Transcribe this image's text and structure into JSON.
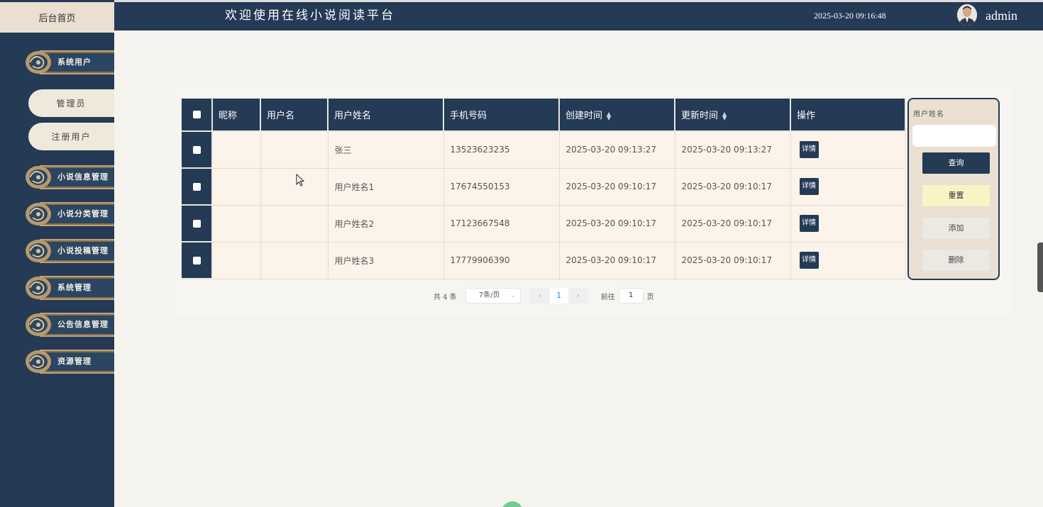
{
  "header": {
    "title": "欢迎使用在线小说阅读平台",
    "datetime": "2025-03-20 09:16:48",
    "username": "admin"
  },
  "sidebar": {
    "home": "后台首页",
    "items": [
      {
        "label": "系统用户"
      },
      {
        "label": "小说信息管理"
      },
      {
        "label": "小说分类管理"
      },
      {
        "label": "小说投稿管理"
      },
      {
        "label": "系统管理"
      },
      {
        "label": "公告信息管理"
      },
      {
        "label": "资源管理"
      }
    ],
    "sub_items": [
      {
        "label": "管理员"
      },
      {
        "label": "注册用户"
      }
    ]
  },
  "table": {
    "columns": [
      "昵称",
      "用户名",
      "用户姓名",
      "手机号码",
      "创建时间",
      "更新时间",
      "操作"
    ],
    "rows": [
      {
        "nickname": "",
        "username": "",
        "real_name": "张三",
        "phone": "13523623235",
        "created": "2025-03-20 09:13:27",
        "updated": "2025-03-20 09:13:27",
        "action": "详情"
      },
      {
        "nickname": "",
        "username": "",
        "real_name": "用户姓名1",
        "phone": "17674550153",
        "created": "2025-03-20 09:10:17",
        "updated": "2025-03-20 09:10:17",
        "action": "详情"
      },
      {
        "nickname": "",
        "username": "",
        "real_name": "用户姓名2",
        "phone": "17123667548",
        "created": "2025-03-20 09:10:17",
        "updated": "2025-03-20 09:10:17",
        "action": "详情"
      },
      {
        "nickname": "",
        "username": "",
        "real_name": "用户姓名3",
        "phone": "17779906390",
        "created": "2025-03-20 09:10:17",
        "updated": "2025-03-20 09:10:17",
        "action": "详情"
      }
    ]
  },
  "search": {
    "label": "用户姓名",
    "input_value": "",
    "query": "查询",
    "reset": "重置",
    "add": "添加",
    "delete": "删除"
  },
  "pagination": {
    "total": "共 4 条",
    "page_size": "7条/页",
    "prev": "‹",
    "current": "1",
    "next": "›",
    "goto_label": "前往",
    "goto_value": "1",
    "goto_unit": "页"
  },
  "colors": {
    "primary": "#243a55",
    "accent_gold": "#bfa27a",
    "cream": "#eadfd0",
    "row_bg": "#fcf4ea"
  }
}
